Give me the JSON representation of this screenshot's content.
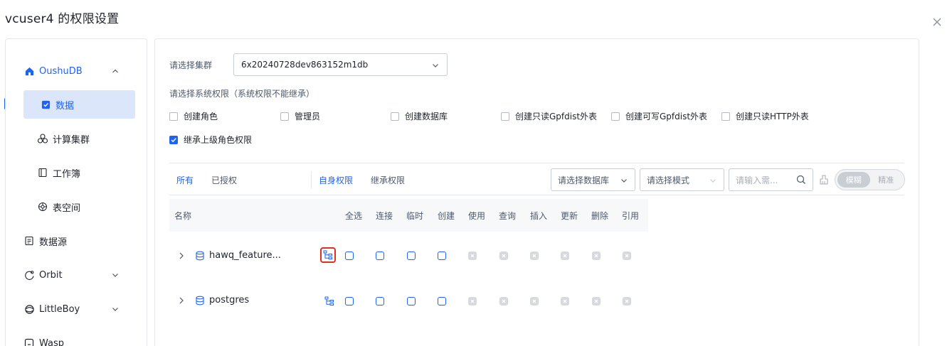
{
  "dialog": {
    "title": "vcuser4 的权限设置"
  },
  "sidebar": {
    "items": [
      {
        "label": "OushuDB"
      },
      {
        "label": "数据"
      },
      {
        "label": "计算集群"
      },
      {
        "label": "工作簿"
      },
      {
        "label": "表空间"
      },
      {
        "label": "数据源"
      },
      {
        "label": "Orbit"
      },
      {
        "label": "LittleBoy"
      },
      {
        "label": "Wasp"
      }
    ]
  },
  "main": {
    "cluster_label": "请选择集群",
    "cluster_value": "6x20240728dev863152m1db",
    "sys_perm_label": "请选择系统权限（系统权限不能继承）",
    "sys_perms": [
      {
        "label": "创建角色",
        "checked": false
      },
      {
        "label": "管理员",
        "checked": false
      },
      {
        "label": "创建数据库",
        "checked": false
      },
      {
        "label": "创建只读Gpfdist外表",
        "checked": false
      },
      {
        "label": "创建可写Gpfdist外表",
        "checked": false
      },
      {
        "label": "创建只读HTTP外表",
        "checked": false
      }
    ],
    "inherit_label": "继承上级角色权限",
    "tabs_left": [
      "所有",
      "已授权"
    ],
    "tabs_right": [
      "自身权限",
      "继承权限"
    ],
    "filter_db": "请选择数据库",
    "filter_schema": "请选择模式",
    "search_placeholder": "请输入需...",
    "toggle": {
      "fuzzy": "模糊",
      "exact": "精准"
    },
    "columns": [
      "名称",
      "全选",
      "连接",
      "临时",
      "创建",
      "使用",
      "查询",
      "插入",
      "更新",
      "删除",
      "引用"
    ],
    "rows": [
      {
        "name": "hawq_feature..."
      },
      {
        "name": "postgres"
      }
    ]
  },
  "colors": {
    "accent": "#1d64f2",
    "highlight": "#e0301e",
    "selected_bg": "#dbe6fb"
  }
}
